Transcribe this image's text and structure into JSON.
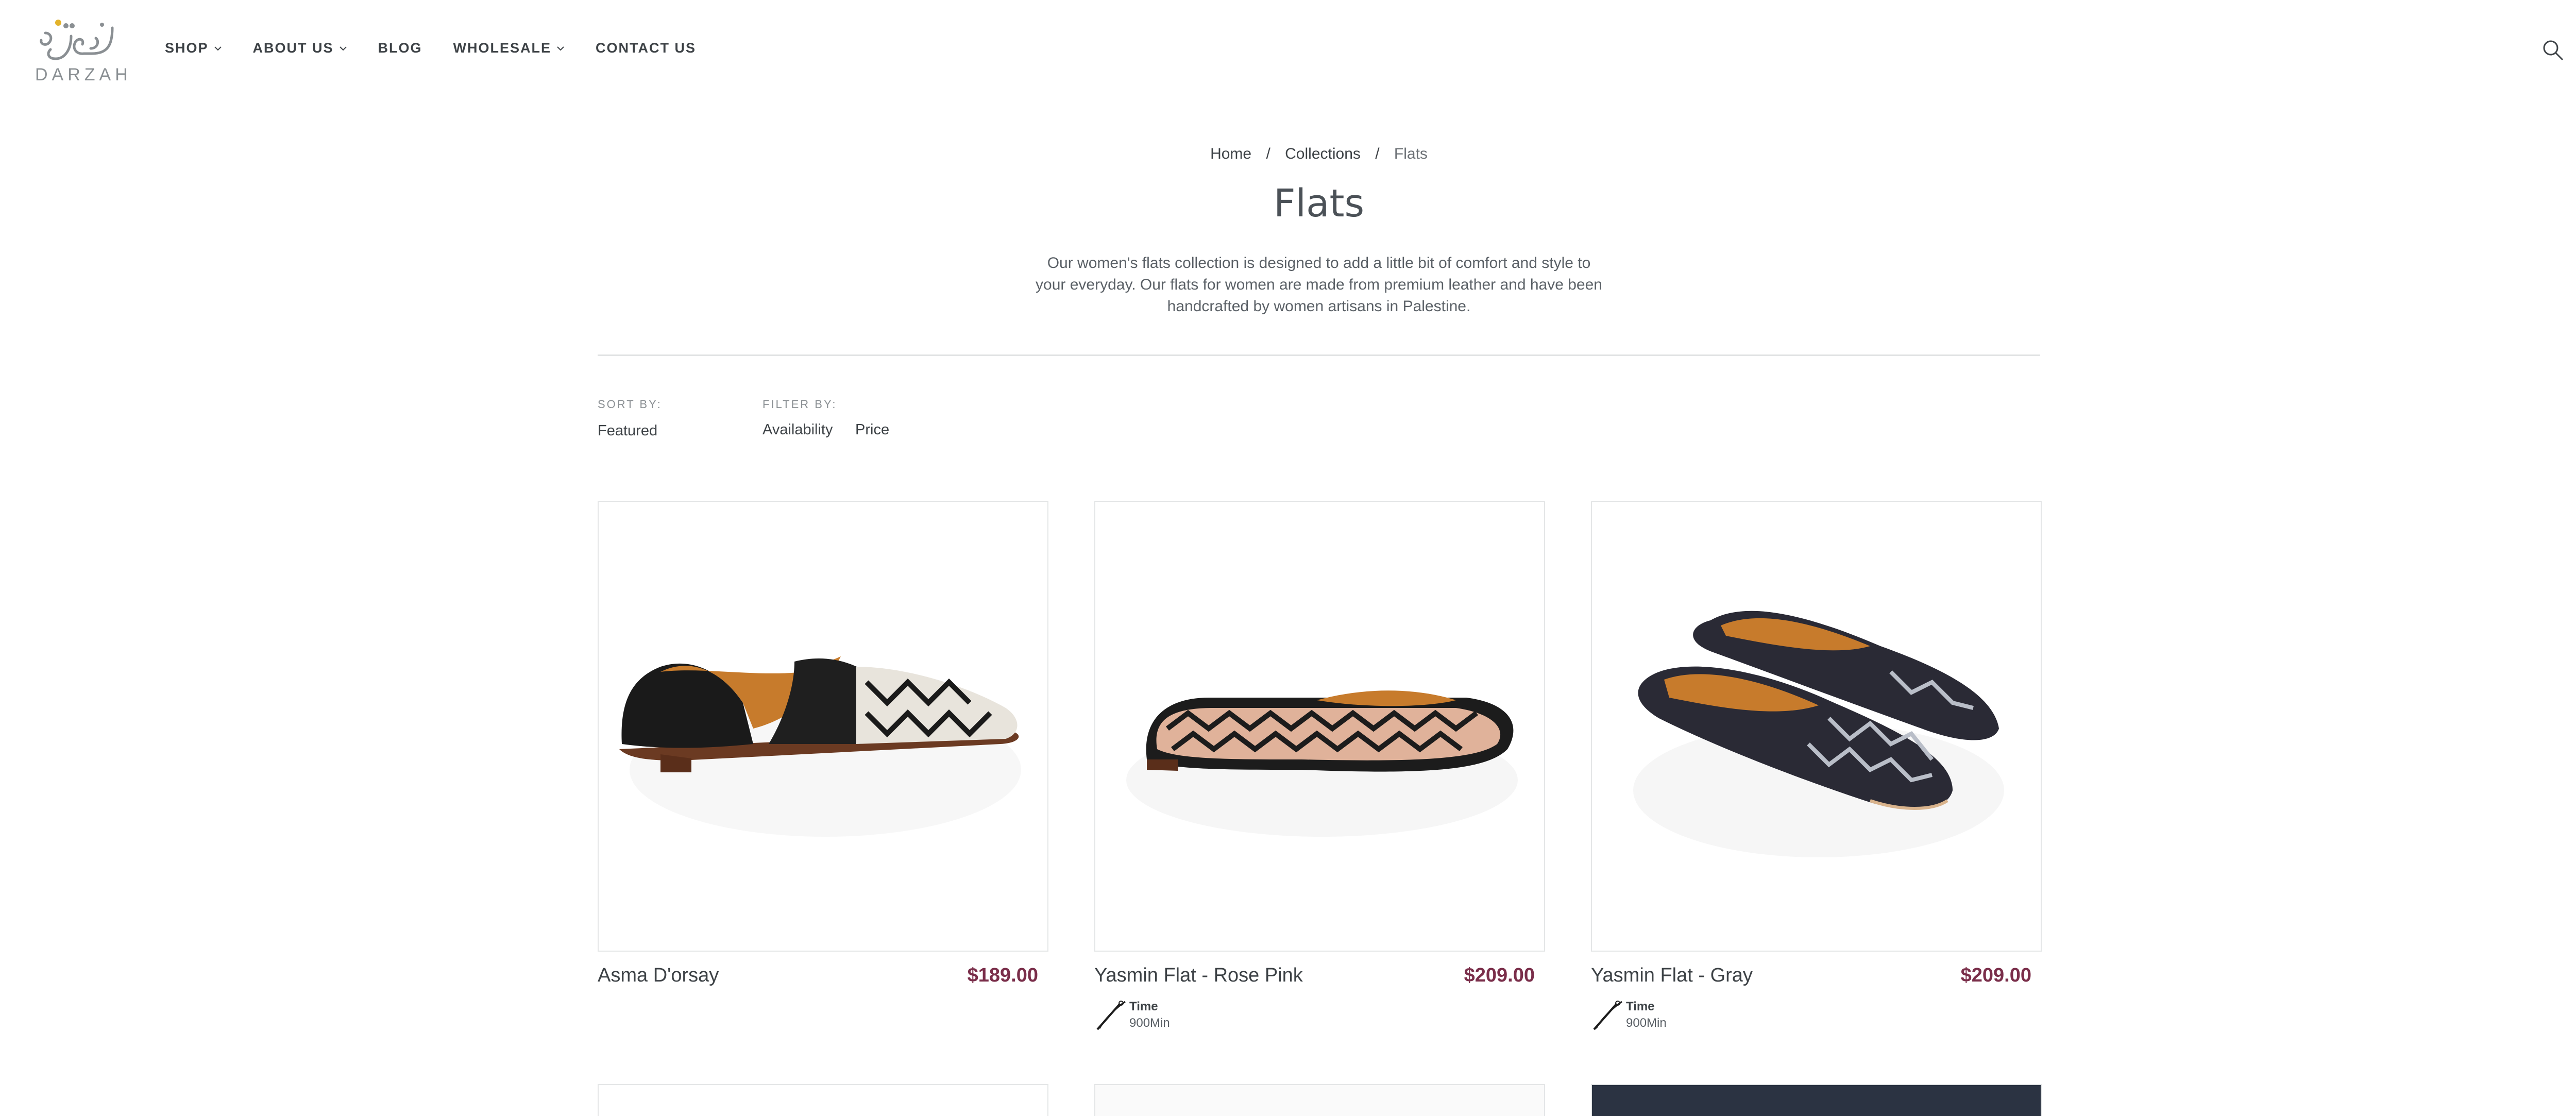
{
  "brand": {
    "logo_text": "DARZAH",
    "logo_arabic": "درزة"
  },
  "nav": {
    "items": [
      {
        "label": "SHOP",
        "has_dropdown": true
      },
      {
        "label": "ABOUT US",
        "has_dropdown": true
      },
      {
        "label": "BLOG",
        "has_dropdown": false
      },
      {
        "label": "WHOLESALE",
        "has_dropdown": true
      },
      {
        "label": "CONTACT US",
        "has_dropdown": false
      }
    ],
    "icons": [
      "search-icon",
      "cart-icon"
    ]
  },
  "breadcrumb": {
    "home": "Home",
    "collections": "Collections",
    "current": "Flats",
    "separator": "/"
  },
  "collection": {
    "title": "Flats",
    "description": "Our women's flats collection is designed to add a little bit of comfort and style to your everyday. Our flats for women are made from premium leather and have been handcrafted by women artisans in Palestine."
  },
  "sort": {
    "label": "SORT BY:",
    "value": "Featured"
  },
  "filter": {
    "label": "FILTER BY:",
    "options": [
      "Availability",
      "Price"
    ]
  },
  "products": [
    {
      "name": "Asma D'orsay",
      "price": "$189.00",
      "time_label": null,
      "time_value": null
    },
    {
      "name": "Yasmin Flat - Rose Pink",
      "price": "$209.00",
      "time_label": "Time",
      "time_value": "900Min"
    },
    {
      "name": "Yasmin Flat - Gray",
      "price": "$209.00",
      "time_label": "Time",
      "time_value": "900Min"
    }
  ],
  "colors": {
    "text": "#3d4246",
    "price": "#7a2e4a",
    "border": "#e4e6e7",
    "logo_accent": "#e3b32b"
  }
}
